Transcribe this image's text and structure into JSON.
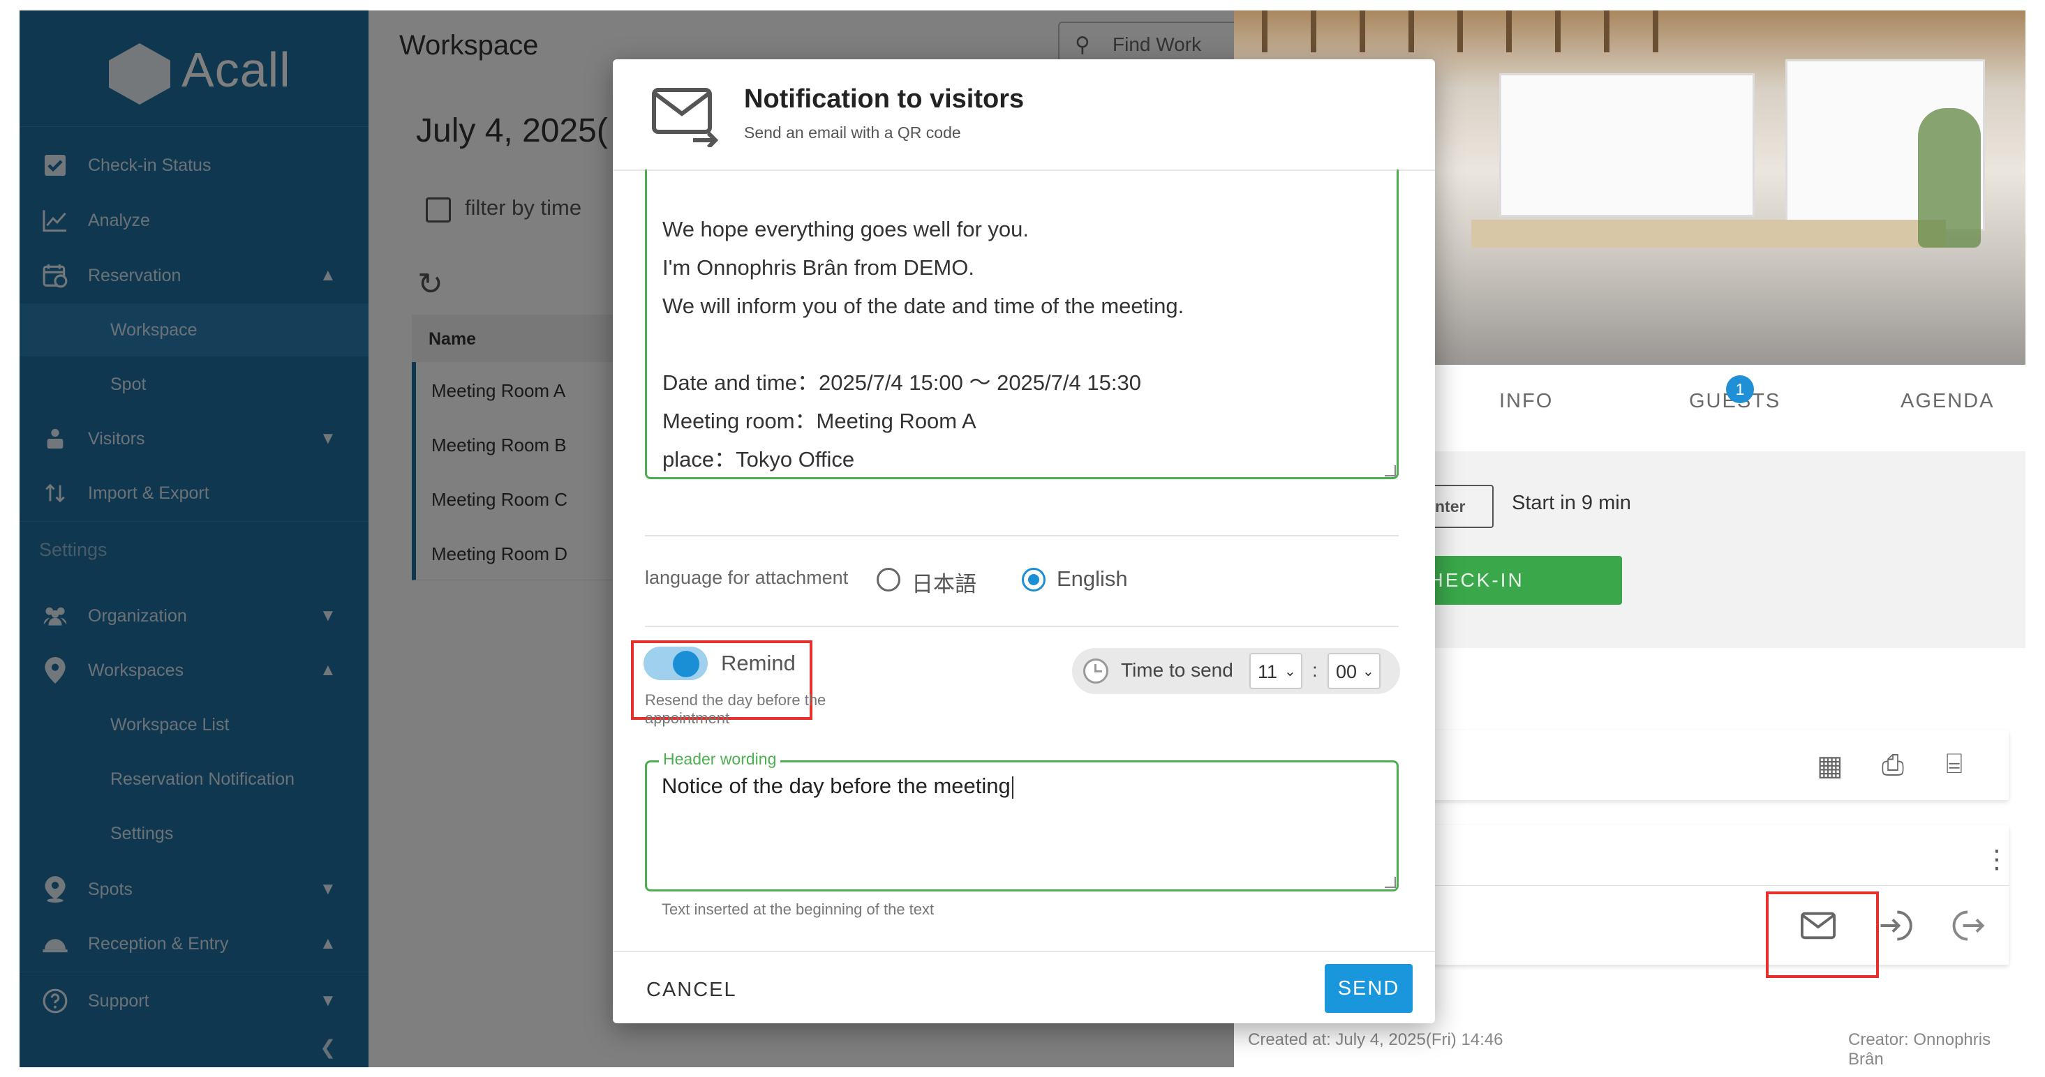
{
  "sidebar": {
    "logo_text": "Acall",
    "items": [
      {
        "label": "Check-in Status",
        "icon": "check-square-icon"
      },
      {
        "label": "Analyze",
        "icon": "chart-line-icon"
      },
      {
        "label": "Reservation",
        "icon": "calendar-clock-icon"
      },
      {
        "label": "Workspace"
      },
      {
        "label": "Spot"
      },
      {
        "label": "Visitors",
        "icon": "person-desk-icon"
      },
      {
        "label": "Import & Export",
        "icon": "import-export-icon"
      }
    ],
    "settings_section": "Settings",
    "settings_items": [
      {
        "label": "Organization",
        "icon": "people-icon"
      },
      {
        "label": "Workspaces",
        "icon": "map-pin-icon"
      },
      {
        "label": "Workspace List"
      },
      {
        "label": "Reservation Notification"
      },
      {
        "label": "Settings"
      },
      {
        "label": "Spots",
        "icon": "map-pin-person-icon"
      },
      {
        "label": "Reception & Entry",
        "icon": "reception-bell-icon"
      },
      {
        "label": "Support",
        "icon": "help-circle-icon"
      }
    ]
  },
  "main": {
    "title": "Workspace",
    "date": "July 4, 2025(",
    "find_button": "Find Work",
    "filter_label": "filter by time",
    "table_header": "Name",
    "rooms": [
      "Meeting Room A",
      "Meeting Room B",
      "Meeting Room C",
      "Meeting Room D"
    ]
  },
  "detail": {
    "tabs": [
      "INFO",
      "GUESTS",
      "AGENDA"
    ],
    "guests_count": "1",
    "status_badge": "Waiting to enter",
    "start_text": "Start in 9 min",
    "checkin_button": "CHECK-IN",
    "created": "Created at: July 4, 2025(Fri) 14:46",
    "creator": "Creator: Onnophris Brân"
  },
  "modal": {
    "title": "Notification to visitors",
    "subtitle": "Send an email with a QR code",
    "body_lines": [
      "We hope everything goes well for you.",
      "I'm Onnophris Brân from DEMO.",
      "We will inform you of the date and time of the meeting.",
      "",
      "Date and time：2025/7/4 15:00 〜 2025/7/4 15:30",
      "Meeting room：Meeting Room A",
      "place：Tokyo Office"
    ],
    "language_label": "language for attachment",
    "lang_options": [
      "日本語",
      "English"
    ],
    "lang_selected": "English",
    "remind_label": "Remind",
    "remind_on": true,
    "remind_help": "Resend the day before the appointment",
    "time_to_send_label": "Time to send",
    "hour": "11",
    "minute": "00",
    "header_wording_label": "Header wording",
    "header_wording_value": "Notice of the day before the meeting",
    "header_wording_help": "Text inserted at the beginning of the text",
    "cancel": "CANCEL",
    "send": "SEND"
  },
  "colors": {
    "sidebar": "#1f6fa1",
    "accent": "#1a96dd",
    "checkin_green": "#3aa84a",
    "field_border_green": "#4caf50",
    "highlight_red": "#e5302b"
  }
}
